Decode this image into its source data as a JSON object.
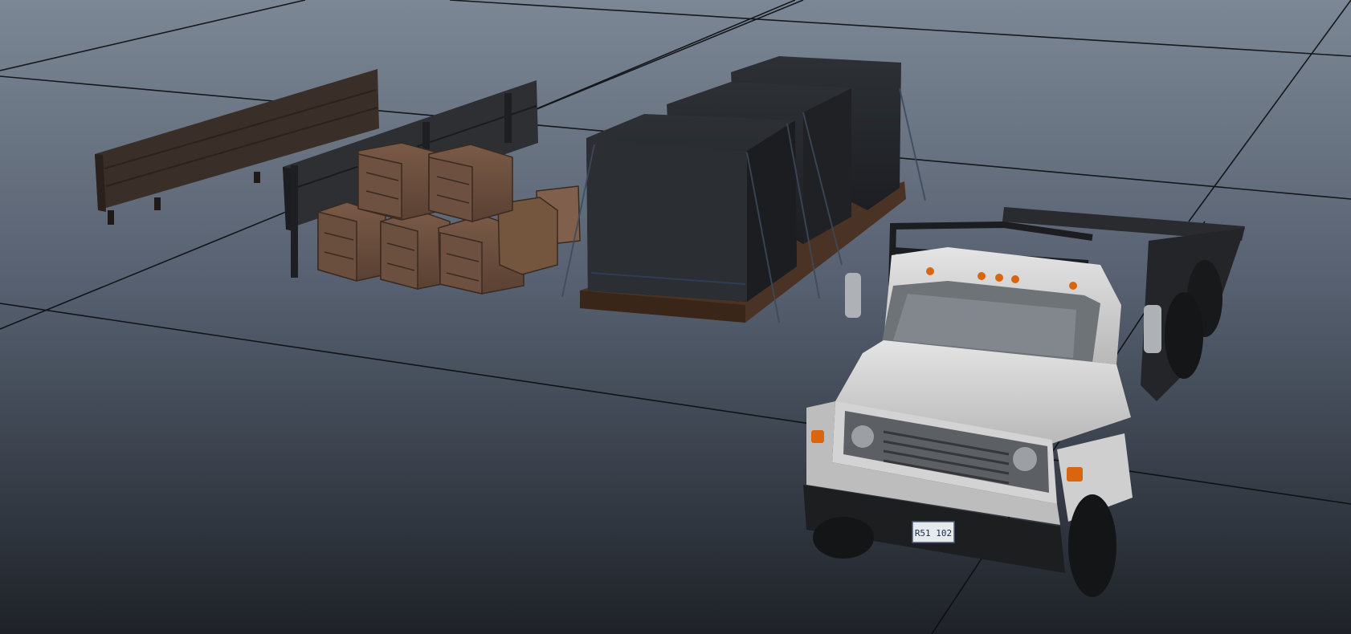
{
  "viewport": {
    "background_top": "#7c8795",
    "background_bottom": "#1e2228",
    "grid_line_color": "#0b0d10"
  },
  "scene": {
    "objects": [
      {
        "name": "wooden-side-panel",
        "color": "#3a2e28"
      },
      {
        "name": "dark-side-panel",
        "color": "#2a2c30"
      },
      {
        "name": "wooden-crates",
        "color": "#6e5040"
      },
      {
        "name": "tarp-covered-pallet-cargo",
        "color": "#24272b"
      },
      {
        "name": "flatbed-truck",
        "cab_color": "#d6d6d6",
        "bed_color": "#2a2b2e",
        "marker_light_color": "#d9660e"
      }
    ],
    "license_plate": "R51 102"
  }
}
